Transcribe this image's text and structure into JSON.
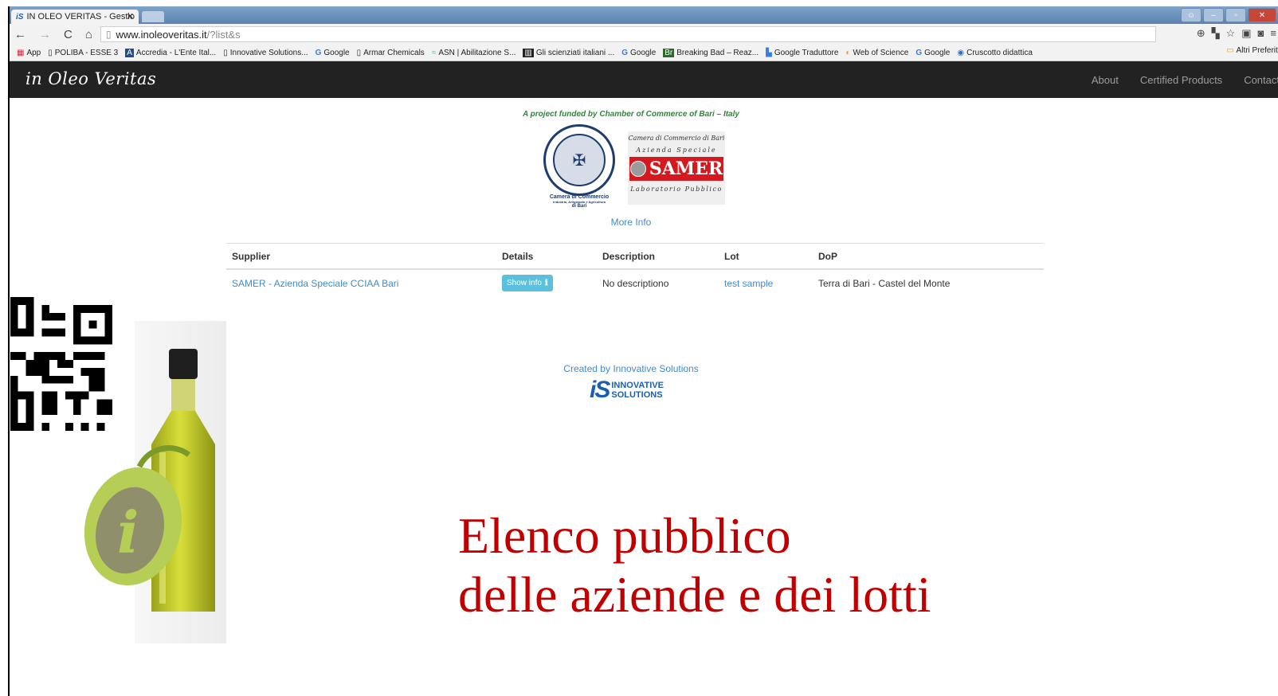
{
  "browser": {
    "tab_title": "IN OLEO VERITAS - Gestio",
    "tab_favicon": "iS",
    "url_host": "www.inoleoveritas.it",
    "url_path": "/?list&s"
  },
  "bookmarks": [
    {
      "icon": "apps-icon",
      "label": "App"
    },
    {
      "icon": "page-icon",
      "label": "POLIBA - ESSE 3"
    },
    {
      "icon": "a-icon",
      "label": "Accredia - L'Ente Ital..."
    },
    {
      "icon": "page-icon",
      "label": "Innovative Solutions..."
    },
    {
      "icon": "google-icon",
      "label": "Google"
    },
    {
      "icon": "page-icon",
      "label": "Armar Chemicals"
    },
    {
      "icon": "asn-icon",
      "label": "ASN | Abilitazione S..."
    },
    {
      "icon": "page-icon",
      "label": "Gli scienziati italiani ..."
    },
    {
      "icon": "google-icon",
      "label": "Google"
    },
    {
      "icon": "bb-icon",
      "label": "Breaking Bad – Reaz..."
    },
    {
      "icon": "translate-icon",
      "label": "Google Traduttore"
    },
    {
      "icon": "wos-icon",
      "label": "Web of Science"
    },
    {
      "icon": "google-icon",
      "label": "Google"
    },
    {
      "icon": "cruscotto-icon",
      "label": "Cruscotto didattica"
    }
  ],
  "bookmarks_other": "Altri Preferiti",
  "site": {
    "brand": "in Oleo Veritas",
    "nav": [
      "About",
      "Certified Products",
      "Contact"
    ],
    "funded_by": "A project funded by Chamber of Commerce of Bari – Italy",
    "seal_caption_1": "Camera di Commercio",
    "seal_caption_2": "Industria, Artigianato e Agricoltura",
    "seal_caption_3": "di Bari",
    "samer_line1": "Camera di Commercio di Bari",
    "samer_line2": "Azienda Speciale",
    "samer_brand": "SAMER",
    "samer_line4": "Laboratorio Pubblico",
    "more_info": "More Info",
    "created_by": "Created by Innovative Solutions",
    "is_logo_mark": "iS",
    "is_logo_line1": "INNOVATIVE",
    "is_logo_line2": "SOLUTIONS"
  },
  "table": {
    "headers": [
      "Supplier",
      "Details",
      "Description",
      "Lot",
      "DoP"
    ],
    "rows": [
      {
        "supplier": "SAMER - Azienda Speciale CCIAA Bari",
        "details_button": "Show info",
        "details_icon": "info-icon",
        "description": "No descriptiono",
        "lot": "test sample",
        "dop": "Terra di Bari - Castel del Monte"
      }
    ]
  },
  "overlay": {
    "title_line1": "Elenco pubblico",
    "title_line2": "delle aziende e dei lotti"
  },
  "colors": {
    "navbar": "#222222",
    "link": "#428bca",
    "info_button": "#5bc0de",
    "overlay_title": "#c00000",
    "funded_text": "#2c8a3a"
  }
}
